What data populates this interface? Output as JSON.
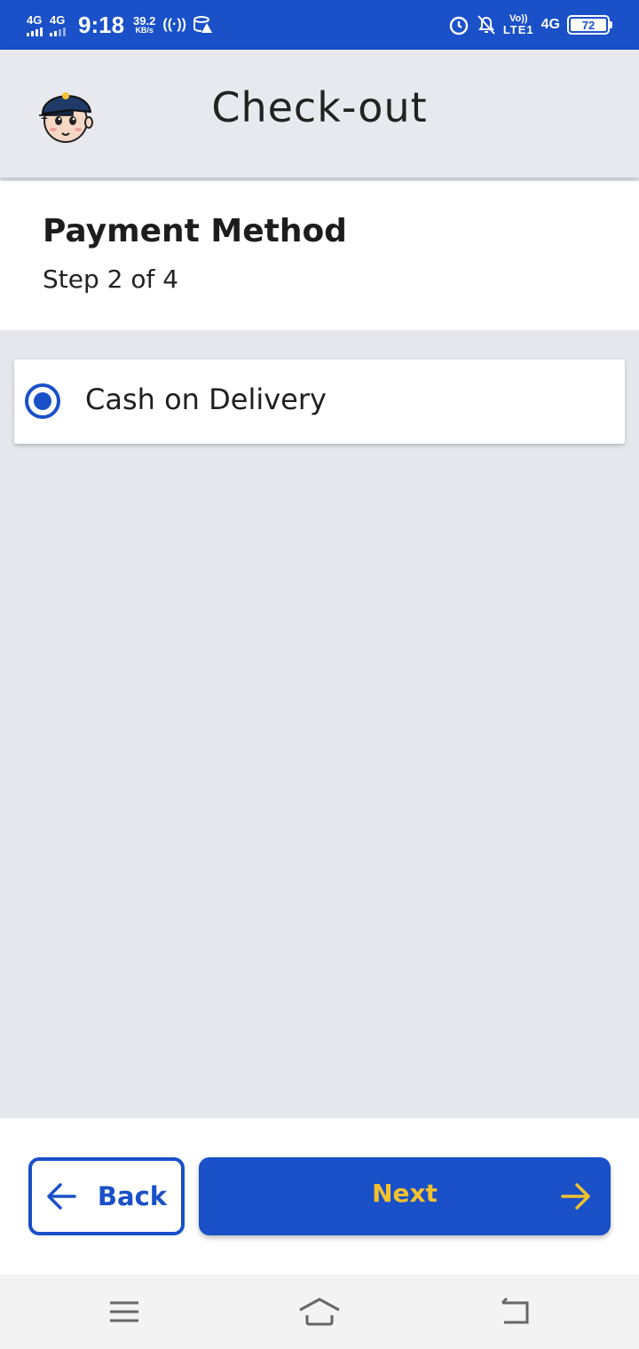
{
  "status_bar": {
    "network1": "4G",
    "network2": "4G",
    "time": "9:18",
    "speed_value": "39.2",
    "speed_unit": "KB/s",
    "volte_top": "Vo))",
    "volte_bottom": "LTE1",
    "network3": "4G",
    "battery": "72"
  },
  "app_bar": {
    "title": "Check-out",
    "avatar_icon": "cartoon-avatar-icon"
  },
  "section": {
    "title": "Payment Method",
    "subtitle": "Step 2 of 4"
  },
  "payment_options": [
    {
      "label": "Cash on Delivery",
      "selected": true
    }
  ],
  "footer": {
    "back_label": "Back",
    "next_label": "Next"
  },
  "colors": {
    "primary": "#1a50c8",
    "accent": "#f2c12e",
    "background": "#e6e7ec"
  },
  "nav_bar": {
    "icons": [
      "menu-icon",
      "home-icon",
      "back-icon"
    ]
  }
}
